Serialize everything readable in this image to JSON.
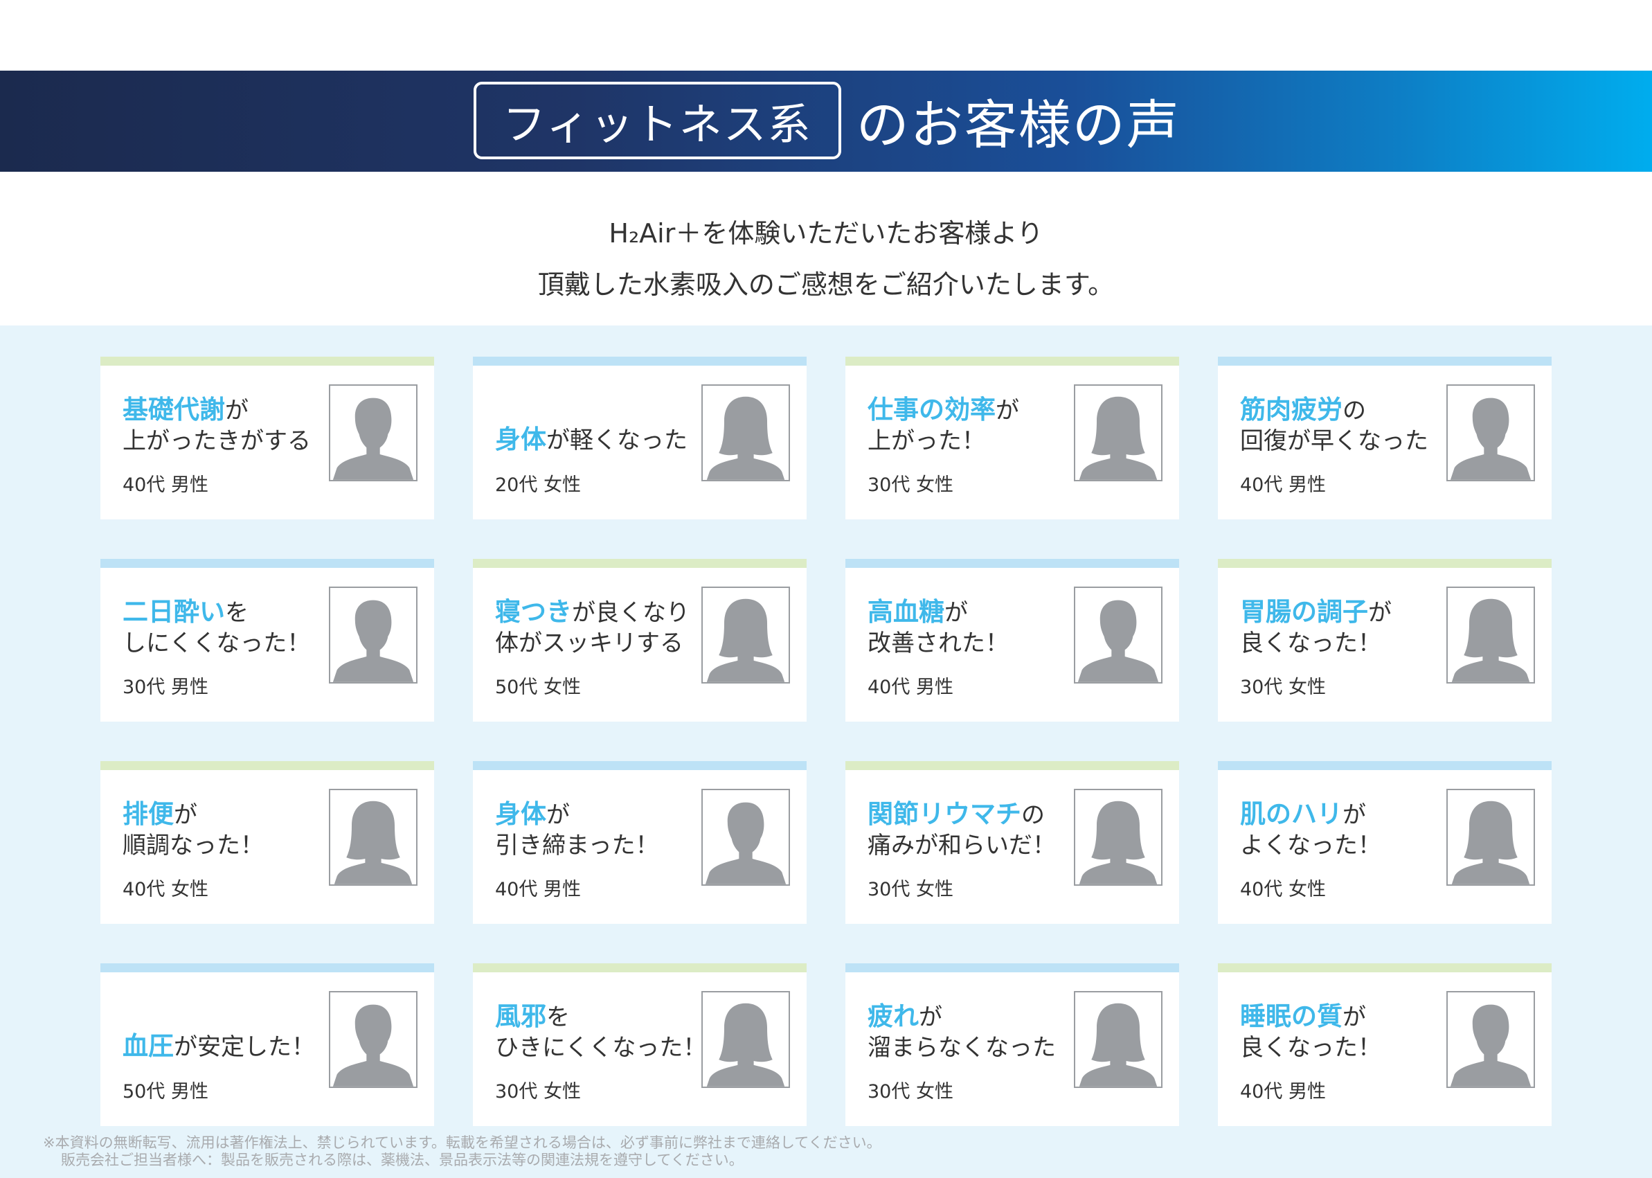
{
  "banner": {
    "box_text": "フィットネス系",
    "rest_text": "のお客様の声"
  },
  "intro": {
    "line1": "H₂Air＋を体験いただいたお客様より",
    "line2": "頂戴した水素吸入のご感想をご紹介いたします。"
  },
  "cards": [
    {
      "hl": "基礎代謝",
      "rest": "が",
      "line2": "上がったきがする",
      "age": "40代 男性"
    },
    {
      "hl": "身体",
      "rest": "が軽くなった",
      "line2": "",
      "age": "20代 女性"
    },
    {
      "hl": "仕事の効率",
      "rest": "が",
      "line2": "上がった！",
      "age": "30代 女性"
    },
    {
      "hl": "筋肉疲労",
      "rest": "の",
      "line2": "回復が早くなった",
      "age": "40代 男性"
    },
    {
      "hl": "二日酔い",
      "rest": "を",
      "line2": "しにくくなった！",
      "age": "30代 男性"
    },
    {
      "hl": "寝つき",
      "rest": "が良くなり",
      "line2": "体がスッキリする",
      "age": "50代 女性"
    },
    {
      "hl": "高血糖",
      "rest": "が",
      "line2": "改善された！",
      "age": "40代 男性"
    },
    {
      "hl": "胃腸の調子",
      "rest": "が",
      "line2": "良くなった！",
      "age": "30代 女性"
    },
    {
      "hl": "排便",
      "rest": "が",
      "line2": "順調なった！",
      "age": "40代 女性"
    },
    {
      "hl": "身体",
      "rest": "が",
      "line2": "引き締まった！",
      "age": "40代 男性"
    },
    {
      "hl": "関節リウマチ",
      "rest": "の",
      "line2": "痛みが和らいだ！",
      "age": "30代 女性"
    },
    {
      "hl": "肌のハリ",
      "rest": "が",
      "line2": "よくなった！",
      "age": "40代 女性"
    },
    {
      "hl": "血圧",
      "rest": "が安定した！",
      "line2": "",
      "age": "50代 男性"
    },
    {
      "hl": "風邪",
      "rest": "を",
      "line2": "ひきにくくなった！",
      "age": "30代 女性"
    },
    {
      "hl": "疲れ",
      "rest": "が",
      "line2": "溜まらなくなった",
      "age": "30代 女性"
    },
    {
      "hl": "睡眠の質",
      "rest": "が",
      "line2": "良くなった！",
      "age": "40代 男性"
    }
  ],
  "footer": {
    "line1": "※本資料の無断転写、流用は著作権法上、禁じられています。転載を希望される場合は、必ず事前に弊社まで連絡してください。",
    "line2": "販売会社ご担当者様へ：製品を販売される際は、薬機法、景品表示法等の関連法規を遵守してください。"
  },
  "colors": {
    "highlight": "#3fb8ea",
    "bar_green": "#dcecc5",
    "bar_blue": "#bde2f6",
    "panel": "#e6f4fb",
    "silhouette": "#9a9da1"
  }
}
